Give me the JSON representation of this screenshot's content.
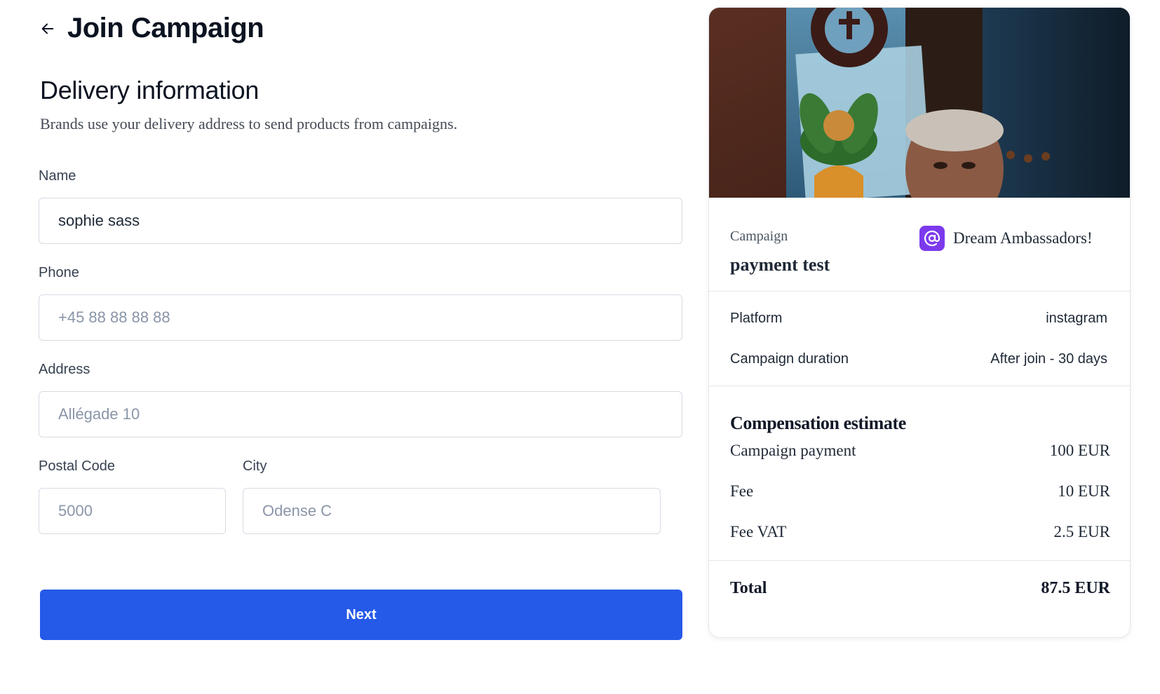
{
  "header": {
    "title": "Join Campaign",
    "back_icon": "arrow-left-icon"
  },
  "section": {
    "title": "Delivery information",
    "subtitle": "Brands use your delivery address to send products from campaigns."
  },
  "form": {
    "name": {
      "label": "Name",
      "value": "sophie sass",
      "placeholder": ""
    },
    "phone": {
      "label": "Phone",
      "value": "",
      "placeholder": "+45 88 88 88 88"
    },
    "address": {
      "label": "Address",
      "value": "",
      "placeholder": "Allégade 10"
    },
    "postal_code": {
      "label": "Postal Code",
      "value": "",
      "placeholder": "5000"
    },
    "city": {
      "label": "City",
      "value": "",
      "placeholder": "Odense C"
    },
    "next_label": "Next"
  },
  "card": {
    "campaign_label": "Campaign",
    "campaign_name": "payment test",
    "brand_name": "Dream Ambassadors!",
    "brand_icon": "at-sign-icon",
    "details": [
      {
        "label": "Platform",
        "value": "instagram"
      },
      {
        "label": "Campaign duration",
        "value": "After join - 30 days"
      }
    ],
    "compensation_title": "Compensation estimate",
    "compensation": [
      {
        "label": "Campaign payment",
        "value": "100 EUR"
      },
      {
        "label": "Fee",
        "value": "10 EUR"
      },
      {
        "label": "Fee VAT",
        "value": "2.5 EUR"
      }
    ],
    "total": {
      "label": "Total",
      "value": "87.5 EUR"
    }
  },
  "colors": {
    "primary": "#2559e7",
    "brand_logo": "#7c3aed",
    "border": "#d6dbe3"
  }
}
